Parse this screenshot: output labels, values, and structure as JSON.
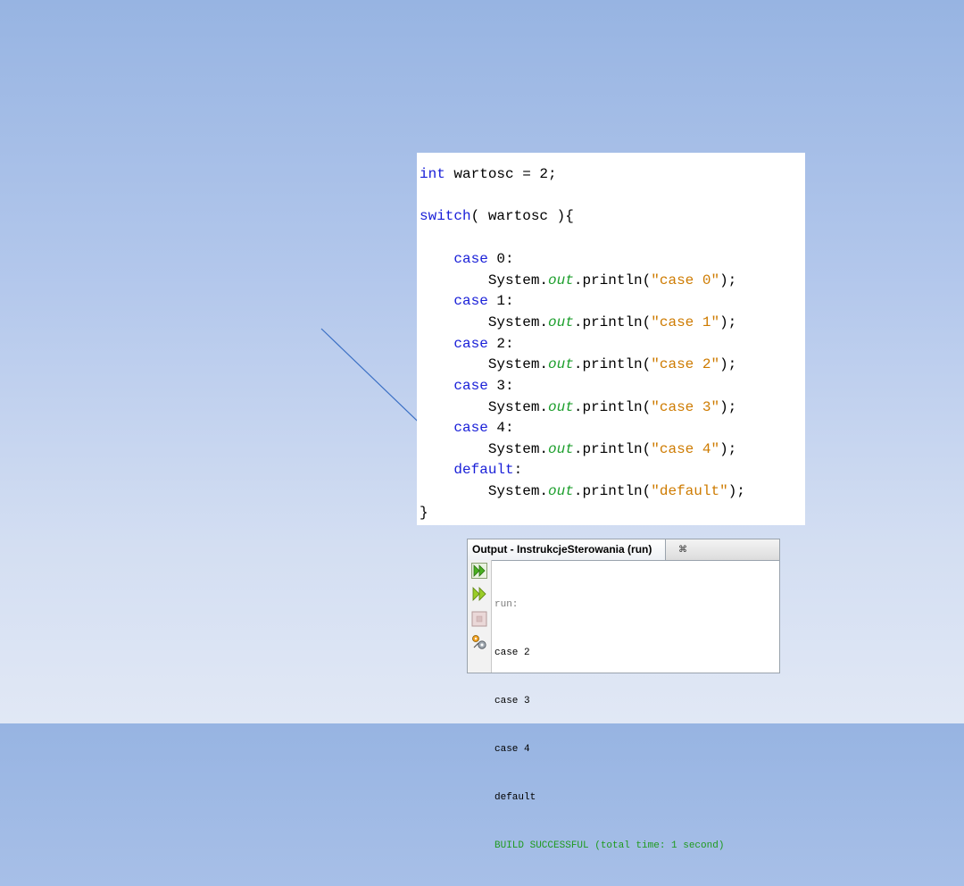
{
  "code": {
    "line1": {
      "kw": "int",
      "rest": " wartosc = 2;"
    },
    "line2": {
      "kw": "switch",
      "rest": "( wartosc ){"
    },
    "cases": [
      {
        "kw": "case",
        "label": " 0:",
        "pre": "System.",
        "field": "out",
        "call": ".println(",
        "str": "\"case 0\"",
        "end": ");"
      },
      {
        "kw": "case",
        "label": " 1:",
        "pre": "System.",
        "field": "out",
        "call": ".println(",
        "str": "\"case 1\"",
        "end": ");"
      },
      {
        "kw": "case",
        "label": " 2:",
        "pre": "System.",
        "field": "out",
        "call": ".println(",
        "str": "\"case 2\"",
        "end": ");"
      },
      {
        "kw": "case",
        "label": " 3:",
        "pre": "System.",
        "field": "out",
        "call": ".println(",
        "str": "\"case 3\"",
        "end": ");"
      },
      {
        "kw": "case",
        "label": " 4:",
        "pre": "System.",
        "field": "out",
        "call": ".println(",
        "str": "\"case 4\"",
        "end": ");"
      }
    ],
    "default": {
      "kw": "default",
      "label": ":",
      "pre": "System.",
      "field": "out",
      "call": ".println(",
      "str": "\"default\"",
      "end": ");"
    },
    "closing": "}"
  },
  "output": {
    "tab_title": "Output - InstrukcjeSterowania (run)",
    "close_glyph": "⌘",
    "lines": {
      "run": "run:",
      "l1": "case 2",
      "l2": "case 3",
      "l3": "case 4",
      "l4": "default",
      "success": "BUILD SUCCESSFUL (total time: 1 second)"
    },
    "toolbar_icons": [
      "rerun-icon",
      "rerun-with-customized-icon",
      "stop-icon",
      "settings-icon"
    ]
  },
  "colors": {
    "keyword": "#1a20d8",
    "field": "#1b9e2b",
    "string": "#ce7b00",
    "success": "#1e9a1e",
    "arrow": "#3a6fc4"
  }
}
